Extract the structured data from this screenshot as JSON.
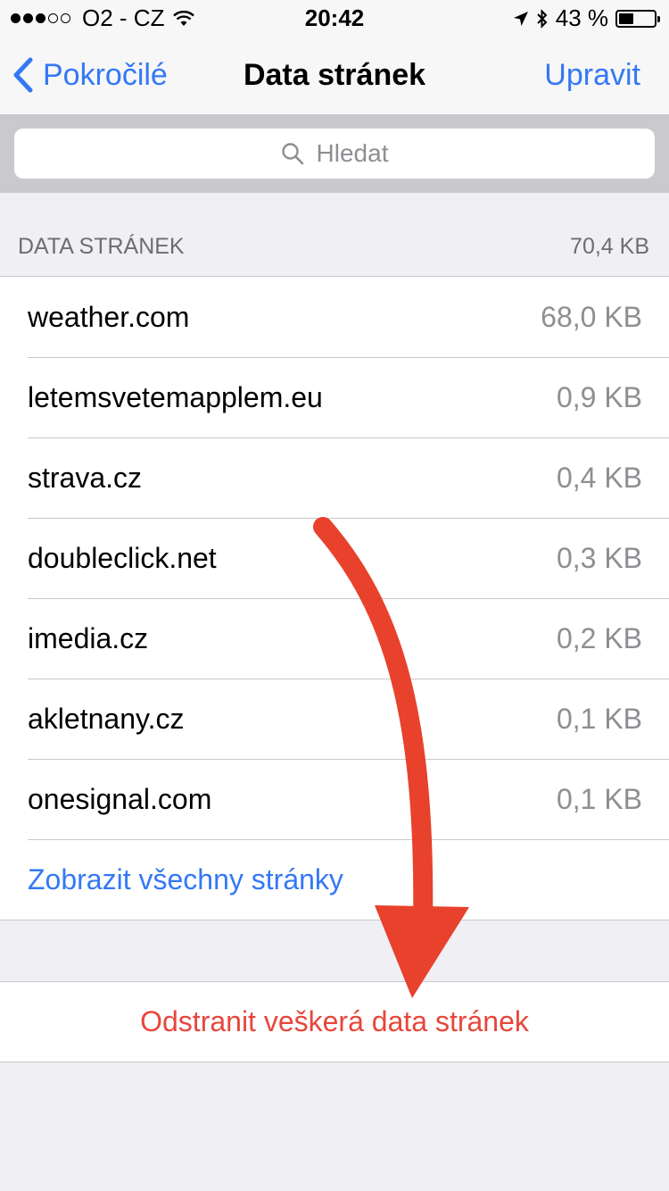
{
  "status_bar": {
    "carrier": "O2 - CZ",
    "time": "20:42",
    "battery_percent": "43 %",
    "battery_level": 0.43
  },
  "nav": {
    "back_label": "Pokročilé",
    "title": "Data stránek",
    "edit_label": "Upravit"
  },
  "search": {
    "placeholder": "Hledat"
  },
  "section": {
    "header": "DATA STRÁNEK",
    "total": "70,4 KB"
  },
  "sites": [
    {
      "name": "weather.com",
      "size": "68,0 KB"
    },
    {
      "name": "letemsvetemapplem.eu",
      "size": "0,9 KB"
    },
    {
      "name": "strava.cz",
      "size": "0,4 KB"
    },
    {
      "name": "doubleclick.net",
      "size": "0,3 KB"
    },
    {
      "name": "imedia.cz",
      "size": "0,2 KB"
    },
    {
      "name": "akletnany.cz",
      "size": "0,1 KB"
    },
    {
      "name": "onesignal.com",
      "size": "0,1 KB"
    }
  ],
  "show_all_label": "Zobrazit všechny stránky",
  "delete_label": "Odstranit veškerá data stránek",
  "colors": {
    "accent": "#3478f6",
    "destructive": "#e8463a",
    "annotation_arrow": "#e8412c"
  }
}
